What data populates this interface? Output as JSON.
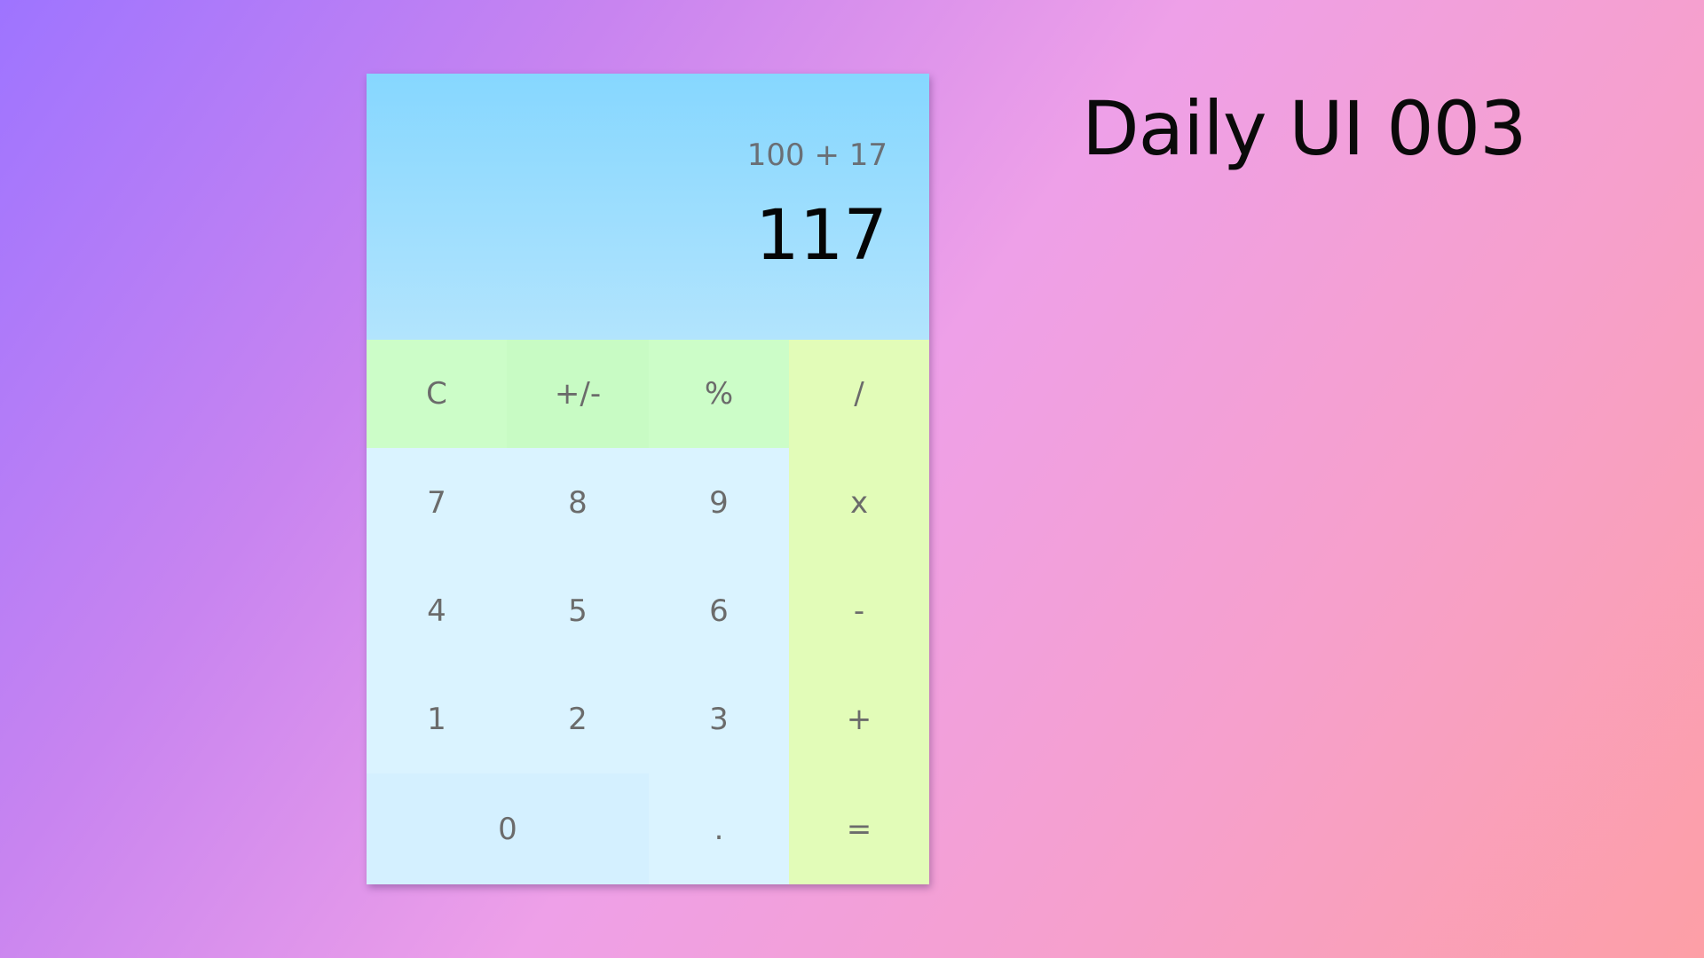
{
  "heading": "Daily UI 003",
  "display": {
    "expression": "100 + 17",
    "result": "117"
  },
  "keys": {
    "clear": "C",
    "toggle_sign": "+/-",
    "percent": "%",
    "divide": "/",
    "seven": "7",
    "eight": "8",
    "nine": "9",
    "multiply": "x",
    "four": "4",
    "five": "5",
    "six": "6",
    "subtract": "-",
    "one": "1",
    "two": "2",
    "three": "3",
    "add": "+",
    "zero": "0",
    "decimal": ".",
    "equals": "="
  },
  "colors": {
    "display_top": "#86d7ff",
    "display_bottom": "#b2e4fd",
    "utility_keys": "#ccfdc8",
    "number_keys": "#daf3ff",
    "operator_keys": "#e2fcb8"
  }
}
